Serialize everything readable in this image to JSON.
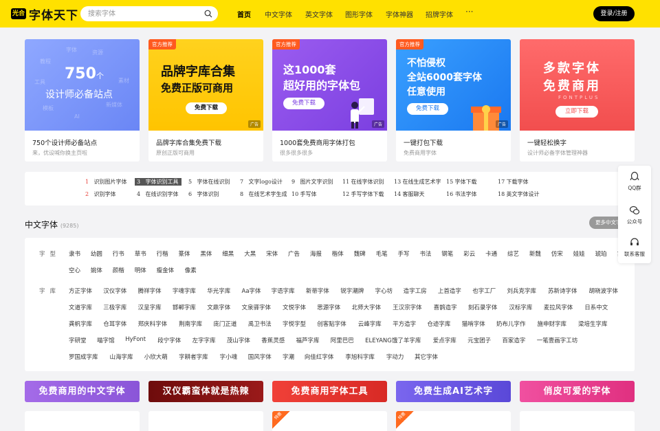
{
  "header": {
    "logo_badge": "光合",
    "logo_text": "字体天下",
    "search_placeholder": "搜索字体",
    "nav": [
      "首页",
      "中文字体",
      "英文字体",
      "图形字体",
      "字体神器",
      "招牌字体"
    ],
    "more": "···",
    "login": "登录/注册"
  },
  "cards": [
    {
      "big": "750",
      "unit": "个",
      "line2": "设计师必备站点",
      "title": "750个设计师必备站点",
      "sub": "来，优设喊你换主页啦",
      "words": [
        "字体",
        "资源",
        "教程",
        "工具",
        "素材",
        "模板",
        "AI",
        "新媒体"
      ]
    },
    {
      "tag": "官方推荐",
      "line1": "品牌字库合集",
      "line2": "免费正版可商用",
      "btn": "免费下载",
      "ad": "广告",
      "title": "品牌字库合集免费下载",
      "sub": "原创正版可商用"
    },
    {
      "tag": "官方推荐",
      "line1": "这1000套",
      "line2": "超好用的字体包",
      "btn": "免费下载",
      "ad": "广告",
      "title": "1000套免费商用字体打包",
      "sub": "很多很多很多"
    },
    {
      "tag": "官方推荐",
      "line1": "不怕侵权",
      "line2": "全站6000套字体",
      "line3": "任意使用",
      "btn": "免费下载",
      "ad": "广告",
      "title": "一键打包下载",
      "sub": "免费商用字体"
    },
    {
      "line1": "多款字体",
      "line2": "免费商用",
      "line3": "FONTPLUS",
      "btn": "立即下载",
      "title": "一键轻松换字",
      "sub": "设计师必备字体管理神器"
    }
  ],
  "rank": [
    {
      "n": "1",
      "t": "识别图片字体"
    },
    {
      "n": "3",
      "t": "字体识别工具"
    },
    {
      "n": "5",
      "t": "字体在线识别"
    },
    {
      "n": "7",
      "t": "文字logo设计"
    },
    {
      "n": "9",
      "t": "图片文字识别"
    },
    {
      "n": "11",
      "t": "在线字体识别"
    },
    {
      "n": "13",
      "t": "在线生成艺术字"
    },
    {
      "n": "15",
      "t": "字体下载"
    },
    {
      "n": "17",
      "t": "下载字体"
    },
    {
      "n": "2",
      "t": "识别字体"
    },
    {
      "n": "4",
      "t": "在线识别字体"
    },
    {
      "n": "6",
      "t": "字体识别"
    },
    {
      "n": "8",
      "t": "在线艺术字生成"
    },
    {
      "n": "10",
      "t": "手写体"
    },
    {
      "n": "12",
      "t": "手写字体下载"
    },
    {
      "n": "14",
      "t": "客服聊天"
    },
    {
      "n": "16",
      "t": "书法字体"
    },
    {
      "n": "18",
      "t": "英文字体设计"
    }
  ],
  "section": {
    "title": "中文字体",
    "count": "(9285)",
    "more": "更多中文字体"
  },
  "styles": {
    "label": "字型",
    "row1": [
      "隶书",
      "幼圆",
      "行书",
      "草书",
      "行楷",
      "篆体",
      "黑体",
      "细黑",
      "大黑",
      "宋体",
      "广告",
      "海报",
      "楷体",
      "魏碑",
      "毛笔",
      "手写",
      "书法",
      "钢笔",
      "彩云",
      "卡通",
      "综艺",
      "新魏",
      "仿宋",
      "娃娃",
      "琥珀",
      "古印"
    ],
    "row2": [
      "空心",
      "姚体",
      "颜楷",
      "明体",
      "瘦金体",
      "像素"
    ]
  },
  "libraries": {
    "label": "字库",
    "rows": [
      [
        "方正字体",
        "汉仪字体",
        "腾祥字体",
        "字魂字库",
        "华光字库",
        "Aa字体",
        "字语字库",
        "新蒂字体",
        "锐字潮牌",
        "字心坊",
        "造字工房",
        "上首造字",
        "也字工厂",
        "刘兵克字库",
        "苏新诗字体",
        "胡晓波字体"
      ],
      [
        "文道字库",
        "三极字库",
        "汉呈字库",
        "邯郸字库",
        "文鼎字体",
        "文泉驿字体",
        "文悦字体",
        "思源字体",
        "北师大字体",
        "王汉宗字体",
        "喜鹊造字",
        "刻石录字体",
        "汉标字库",
        "麦拉风字体",
        "日系中文"
      ],
      [
        "龚帆字库",
        "仓耳字体",
        "郑庆科字体",
        "荆南字库",
        "庞门正道",
        "禹卫书法",
        "字悦字型",
        "创客贴字体",
        "云峰字库",
        "平方造字",
        "仓迹字库",
        "猫啃字体",
        "奶布儿字作",
        "施申财字库",
        "梁培生字库"
      ],
      [
        "字研堂",
        "喵字馆",
        "HyFont",
        "段宁字体",
        "左字字库",
        "茂山字体",
        "香蕉灵感",
        "福芦字库",
        "阿里巴巴",
        "ELEYANG饿了羊字库",
        "爱点字库",
        "元宝团子",
        "百家造字",
        "一笔壹画字工坊"
      ],
      [
        "罗国成字库",
        "山海字库",
        "小欣大萌",
        "字耕者字库",
        "字小魂",
        "国风字体",
        "字潮",
        "向佳红字体",
        "李旭科字库",
        "字动力",
        "其它字体"
      ]
    ]
  },
  "float": [
    "QQ群",
    "公众号",
    "联系客服"
  ],
  "bottom_banners": [
    {
      "text": "免费商用的中文字体",
      "color": "#9a64e0"
    },
    {
      "text": "汉仪霸蛮体就是热辣",
      "color": "#8c1414"
    },
    {
      "text": "免费商用字体工具",
      "color": "#e8332e"
    },
    {
      "text": "免费生成AI艺术字",
      "color": "#6a5ae0"
    },
    {
      "text": "俏皮可爱的字体",
      "color": "#e83a8a"
    }
  ],
  "bottom_card_tag": "特惠"
}
